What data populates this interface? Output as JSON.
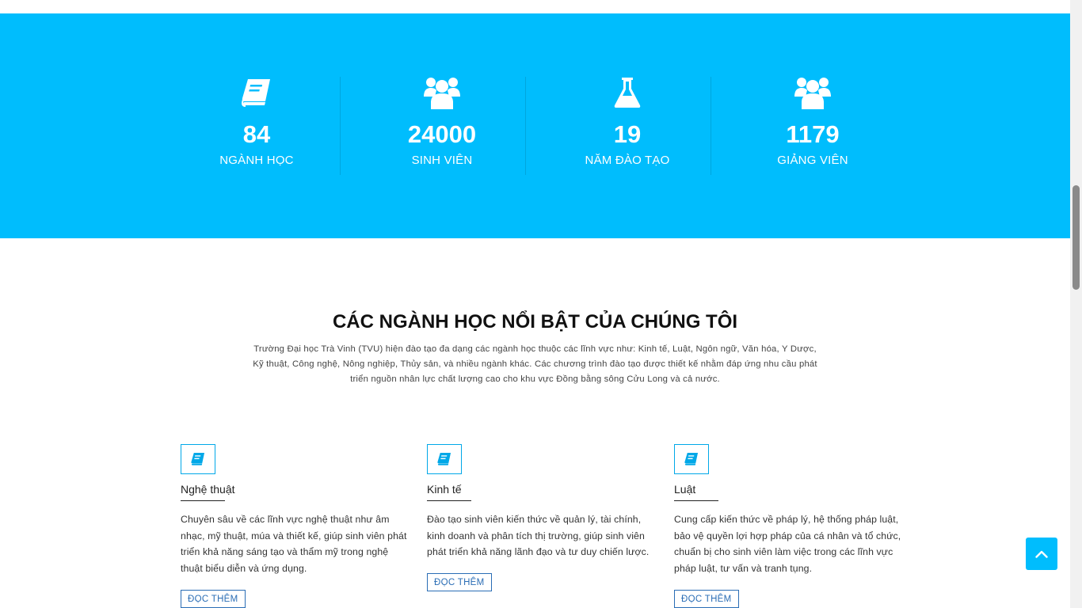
{
  "stats": [
    {
      "icon": "book-icon",
      "value": "84",
      "label": "NGÀNH HỌC"
    },
    {
      "icon": "users-icon",
      "value": "24000",
      "label": "SINH VIÊN"
    },
    {
      "icon": "flask-icon",
      "value": "19",
      "label": "NĂM ĐÀO TẠO"
    },
    {
      "icon": "users-icon",
      "value": "1179",
      "label": "GIẢNG VIÊN"
    }
  ],
  "section": {
    "title": "CÁC NGÀNH HỌC NỔI BẬT CỦA CHÚNG TÔI",
    "description": "Trường Đại học Trà Vinh (TVU) hiện đào tạo đa dạng các ngành học thuộc các lĩnh vực như: Kinh tế, Luật, Ngôn ngữ, Văn hóa, Y Dược, Kỹ thuật, Công nghệ, Nông nghiệp, Thủy sản, và nhiều ngành khác. Các chương trình đào tạo được thiết kế nhằm đáp ứng nhu cầu phát triển nguồn nhân lực chất lượng cao cho khu vực Đồng bằng sông Cửu Long và cả nước."
  },
  "cards": [
    {
      "icon": "book-icon",
      "title": "Nghệ thuật",
      "text": "Chuyên sâu về các lĩnh vực nghệ thuật như âm nhạc, mỹ thuật, múa và thiết kế, giúp sinh viên phát triển khả năng sáng tạo và thẩm mỹ trong nghệ thuật biểu diễn và ứng dụng.",
      "button": "ĐỌC THÊM"
    },
    {
      "icon": "book-icon",
      "title": "Kinh tế",
      "text": "Đào tạo sinh viên kiến thức về quản lý, tài chính, kinh doanh và phân tích thị trường, giúp sinh viên phát triển khả năng lãnh đạo và tư duy chiến lược.",
      "button": "ĐỌC THÊM"
    },
    {
      "icon": "book-icon",
      "title": "Luật",
      "text": "Cung cấp kiến thức về pháp lý, hệ thống pháp luật, bảo vệ quyền lợi hợp pháp của cá nhân và tổ chức, chuẩn bị cho sinh viên làm việc trong các lĩnh vực pháp luật, tư vấn và tranh tụng.",
      "button": "ĐỌC THÊM"
    }
  ],
  "back_to_top": {
    "icon": "chevron-up-icon"
  },
  "colors": {
    "accent": "#00bdfd",
    "button_border": "#2a6db5"
  }
}
